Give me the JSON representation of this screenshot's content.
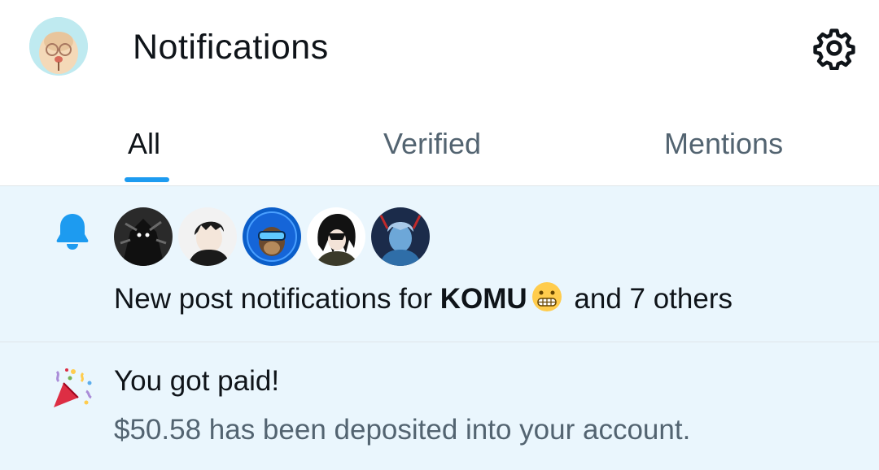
{
  "header": {
    "title": "Notifications",
    "avatar_icon": "sloth-avatar-icon",
    "settings_icon": "gear-icon"
  },
  "tabs": [
    {
      "label": "All",
      "active": true
    },
    {
      "label": "Verified",
      "active": false
    },
    {
      "label": "Mentions",
      "active": false
    }
  ],
  "notifications": [
    {
      "type": "new-post",
      "icon": "bell-icon",
      "avatars": [
        "user-avatar-1",
        "user-avatar-2",
        "user-avatar-3",
        "user-avatar-4",
        "user-avatar-5"
      ],
      "text_prefix": "New post notifications for ",
      "user": "KOMU",
      "emoji": "grimacing-face-emoji",
      "text_suffix": " and 7 others"
    },
    {
      "type": "payment",
      "icon": "party-popper-icon",
      "title": "You got paid!",
      "subtitle": "$50.58 has been deposited into your account."
    }
  ],
  "colors": {
    "accent": "#1d9bf0",
    "notification_bg": "#eaf6fd",
    "primary_text": "#0f1419",
    "secondary_text": "#536471",
    "divider": "#dfe5e9"
  }
}
